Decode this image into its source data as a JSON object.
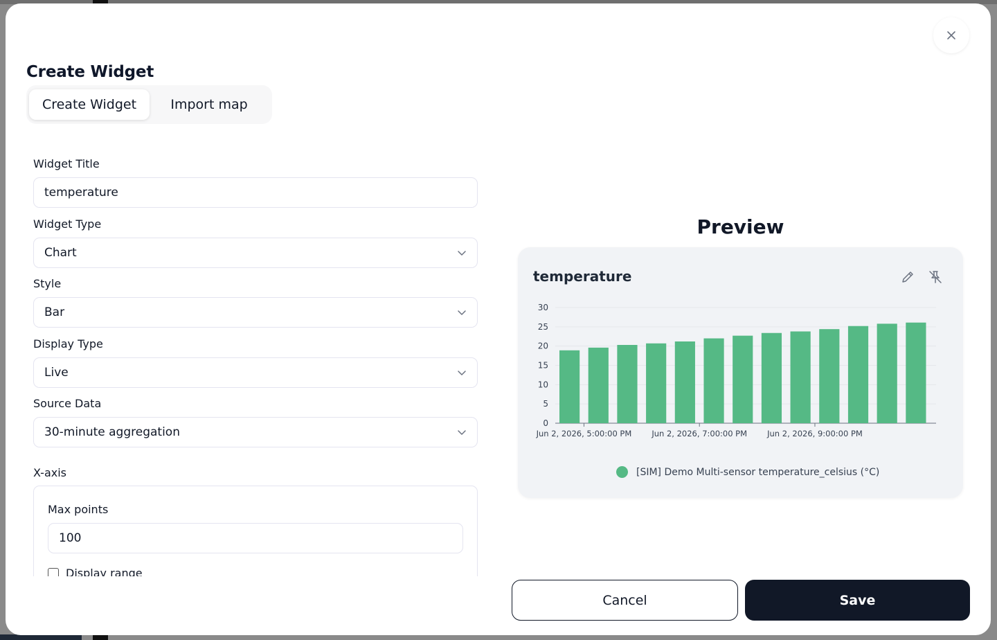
{
  "modal": {
    "title": "Create Widget",
    "tabs": [
      {
        "label": "Create Widget",
        "active": true
      },
      {
        "label": "Import map",
        "active": false
      }
    ]
  },
  "form": {
    "widget_title": {
      "label": "Widget Title",
      "value": "temperature"
    },
    "widget_type": {
      "label": "Widget Type",
      "value": "Chart"
    },
    "style": {
      "label": "Style",
      "value": "Bar"
    },
    "display_type": {
      "label": "Display Type",
      "value": "Live"
    },
    "source_data": {
      "label": "Source Data",
      "value": "30-minute aggregation"
    },
    "x_axis": {
      "label": "X-axis",
      "max_points": {
        "label": "Max points",
        "value": "100"
      },
      "display_range": {
        "label": "Display range",
        "checked": false
      }
    }
  },
  "preview": {
    "heading": "Preview",
    "card_title": "temperature",
    "icons": [
      "pencil-icon",
      "unpin-icon"
    ]
  },
  "chart_data": {
    "type": "bar",
    "title": "temperature",
    "xlabel": "",
    "ylabel": "",
    "ylim": [
      0,
      30
    ],
    "yticks": [
      0,
      5,
      10,
      15,
      20,
      25,
      30
    ],
    "x_tick_labels": [
      "Jun 2, 2026, 5:00:00 PM",
      "Jun 2, 2026, 7:00:00 PM",
      "Jun 2, 2026, 9:00:00 PM"
    ],
    "series": [
      {
        "name": "[SIM] Demo Multi-sensor temperature_celsius (°C)",
        "color": "#55b985",
        "values": [
          18.9,
          19.6,
          20.3,
          20.7,
          21.2,
          22.0,
          22.7,
          23.4,
          23.8,
          24.4,
          25.2,
          25.8,
          26.1
        ]
      }
    ],
    "legend_position": "bottom",
    "grid": "horizontal"
  },
  "actions": {
    "cancel_label": "Cancel",
    "save_label": "Save"
  }
}
